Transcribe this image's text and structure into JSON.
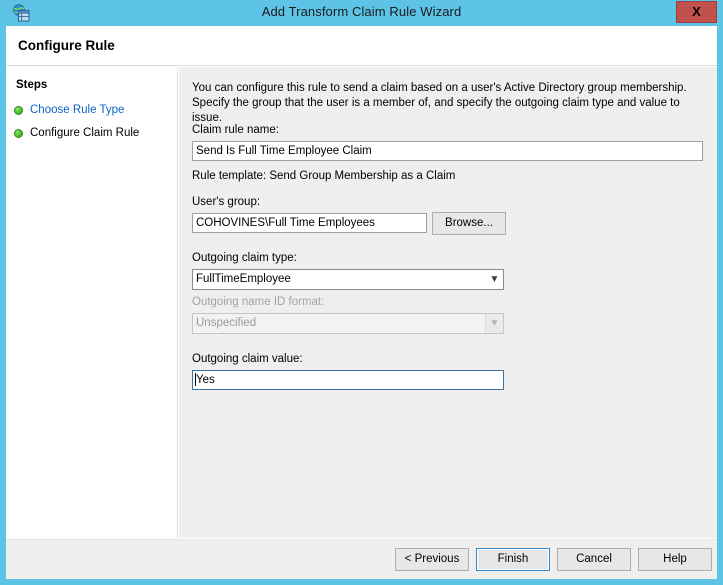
{
  "window": {
    "title": "Add Transform Claim Rule Wizard",
    "app_icon": "adfs-globe-window-icon",
    "close_label": "X",
    "accent_color": "#5ec4e7"
  },
  "header": {
    "page_title": "Configure Rule"
  },
  "steps": {
    "title": "Steps",
    "items": [
      {
        "label": "Choose Rule Type",
        "state": "completed-link"
      },
      {
        "label": "Configure Claim Rule",
        "state": "current"
      }
    ]
  },
  "main": {
    "intro": "You can configure this rule to send a claim based on a user's Active Directory group membership. Specify the group that the user is a member of, and specify the outgoing claim type and value to issue.",
    "claim_rule_name": {
      "label": "Claim rule name:",
      "value": "Send Is Full Time Employee Claim",
      "placeholder": ""
    },
    "rule_template": "Rule template: Send Group Membership as a Claim",
    "users_group": {
      "label": "User's group:",
      "value": "COHOVINES\\Full Time Employees",
      "placeholder": "",
      "browse_label": "Browse..."
    },
    "outgoing_claim_type": {
      "label": "Outgoing claim type:",
      "value": "FullTimeEmployee",
      "arrow_icon": "chevron-down-icon"
    },
    "outgoing_name_id_format": {
      "label": "Outgoing name ID format:",
      "value": "Unspecified",
      "disabled": true,
      "arrow_icon": "chevron-down-icon"
    },
    "outgoing_claim_value": {
      "label": "Outgoing claim value:",
      "value": "Yes",
      "placeholder": "",
      "focused": true
    }
  },
  "footer": {
    "previous_label": "< Previous",
    "finish_label": "Finish",
    "cancel_label": "Cancel",
    "help_label": "Help"
  }
}
